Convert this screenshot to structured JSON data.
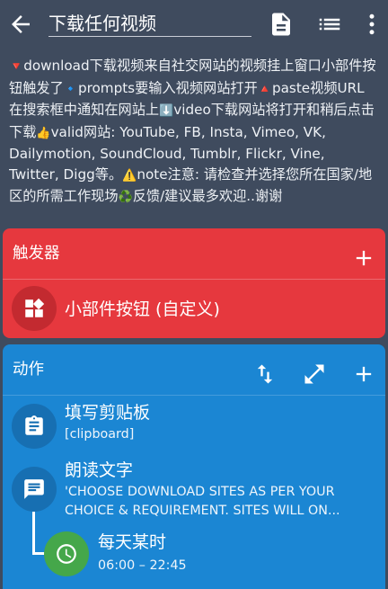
{
  "header": {
    "title": "下载任何视频",
    "icons": [
      "back-arrow-icon",
      "document-icon",
      "list-icon",
      "more-vert-icon"
    ]
  },
  "description": {
    "p1": "download下载视频来自社交网站的视频挂上窗口小部件按钮触发了",
    "p2": "prompts要输入视频网站打开",
    "p3": "paste视频URL在搜索框中通知在网站上",
    "p4": "video下载网站将打开和稍后点击下载",
    "p5": "valid网站: YouTube, FB, Insta, Vimeo, VK, Dailymotion, SoundCloud, Tumblr, Flickr, Vine, Twitter, Digg等。",
    "p6": "note注意: 请检查并选择您所在国家/地区的所需工作现场",
    "p7": "反馈/建议最多欢迎..谢谢"
  },
  "trigger": {
    "title": "触发器",
    "items": [
      {
        "label": "小部件按钮 (自定义)",
        "icon": "widgets-icon"
      }
    ]
  },
  "actions": {
    "title": "动作",
    "items": [
      {
        "title": "填写剪贴板",
        "subtitle": "[clipboard]",
        "icon": "clipboard-icon"
      },
      {
        "title": "朗读文字",
        "subtitle_line1": "'CHOOSE DOWNLOAD SITES AS PER YOUR",
        "subtitle_line2": "CHOICE & REQUIREMENT. SITES WILL ON...",
        "icon": "message-icon"
      },
      {
        "title": "每天某时",
        "subtitle": "06:00 – 22:45",
        "icon": "clock-icon"
      }
    ]
  },
  "colors": {
    "background": "#3f4b5e",
    "trigger": "#e6383e",
    "actions": "#1b86d3",
    "constraint": "#45a74a"
  }
}
